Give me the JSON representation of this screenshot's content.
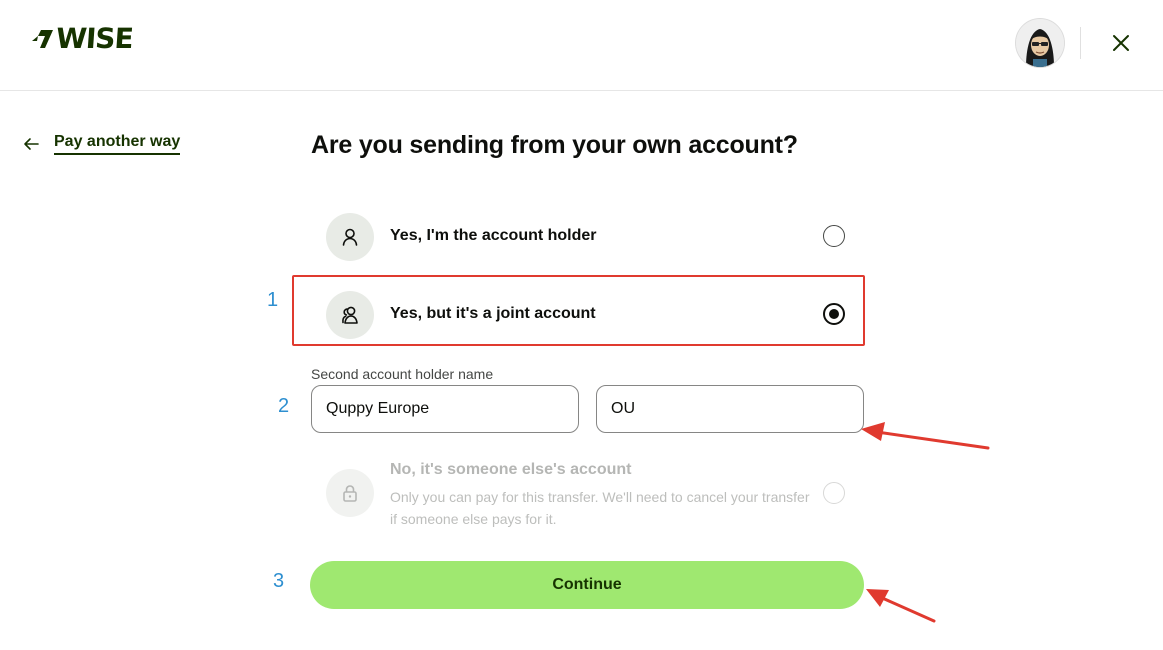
{
  "header": {
    "logo_text": "WISE",
    "logo_icon": "wise-flag-icon",
    "avatar": "user-avatar",
    "close_icon": "close-icon"
  },
  "back_link": {
    "icon": "arrow-left-icon",
    "label": "Pay another way"
  },
  "title": "Are you sending from your own account?",
  "options": [
    {
      "label": "Yes, I'm the account holder",
      "icon": "person-icon",
      "selected": false
    },
    {
      "label": "Yes, but it's a joint account",
      "icon": "people-icon",
      "selected": true
    },
    {
      "label": "No, it's someone else's account",
      "icon": "lock-icon",
      "disabled": true,
      "description": "Only you can pay for this transfer. We'll need to cancel your transfer if someone else pays for it."
    }
  ],
  "second_holder": {
    "label": "Second account holder name",
    "first_value": "Quppy Europe",
    "second_value": "OU"
  },
  "continue_label": "Continue",
  "annotations": {
    "step_1": "1",
    "step_2": "2",
    "step_3": "3",
    "highlight_color": "#e03a2f",
    "number_color": "#2e8fd0"
  },
  "colors": {
    "brand_dark": "#163300",
    "brand_green": "#9fe870"
  }
}
